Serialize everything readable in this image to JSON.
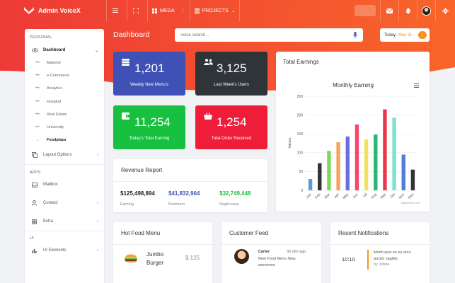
{
  "brand": {
    "name": "Admin VoiceX"
  },
  "topnav": {
    "mega_label": "MEGA",
    "projects_label": "PROJECTS"
  },
  "sidebar": {
    "section_personal": "PERSONAL",
    "dashboard_label": "Dashboard",
    "sub_items": [
      "Material",
      "e-Commerce",
      "Analytics",
      "Hospital",
      "Real Estate",
      "University",
      "Foodplaza"
    ],
    "layout_options": "Layout Options",
    "section_apps": "APPS",
    "mailbox": "Mailbox",
    "contact": "Contact",
    "extra": "Extra",
    "section_ui": "UI",
    "ui_elements": "UI Elements"
  },
  "header": {
    "title": "Dashboard",
    "search_placeholder": "Voice Search...",
    "today_label": "Today:",
    "today_date": "May 31"
  },
  "stats": [
    {
      "value": "1,201",
      "label": "Weekly New Menu's",
      "color": "#3f51b5"
    },
    {
      "value": "3,125",
      "label": "Last Week's Users",
      "color": "#2f3439"
    },
    {
      "value": "11,254",
      "label": "Today's Total Earning",
      "color": "#17c03e"
    },
    {
      "value": "1,254",
      "label": "Total Order Received",
      "color": "#ee1d3a"
    }
  ],
  "revenue": {
    "title": "Revenue Report",
    "items": [
      {
        "value": "$125,498,894",
        "label": "Earning",
        "color": "#222222"
      },
      {
        "value": "$41,832,964",
        "label": "Markham",
        "color": "#3f51b5"
      },
      {
        "value": "$32,749,448",
        "label": "Neglinnaya",
        "color": "#17c03e"
      }
    ]
  },
  "earnings": {
    "title": "Total Earnings",
    "credit": "Highcharts.com"
  },
  "chart_data": {
    "type": "bar",
    "title": "Monthly Earning",
    "ylabel": "Values",
    "xlabel": "",
    "categories": [
      "Jan",
      "Feb",
      "Mar",
      "Apr",
      "May",
      "Jun",
      "Jul",
      "Aug",
      "Sep",
      "Oct",
      "Nov",
      "Dec"
    ],
    "values": [
      30,
      72,
      105,
      128,
      143,
      175,
      135,
      148,
      215,
      193,
      95,
      55
    ],
    "colors": [
      "#5b9bd5",
      "#333333",
      "#7ed957",
      "#f4a460",
      "#6a6fe0",
      "#f4476b",
      "#f1e05a",
      "#2ab673",
      "#e8394a",
      "#7de3d0",
      "#4f7fd9",
      "#333333"
    ],
    "ylim": [
      0,
      250
    ],
    "yticks": [
      0,
      50,
      100,
      150,
      200,
      250
    ],
    "grid": true,
    "legend": "none"
  },
  "hot_food": {
    "title": "Hot Food Menu",
    "item_name": "Jumbo Burger",
    "item_price": "$ 125"
  },
  "feed": {
    "title": "Customer Feed",
    "name": "Carter",
    "time": "33 min ago",
    "text": "New Food Menu Was awesome"
  },
  "notifications": {
    "title": "Resent Notifications",
    "time": "10:10",
    "text": "Morbi quis ex eu arcu auctor sagittis",
    "by": "by Johne"
  }
}
